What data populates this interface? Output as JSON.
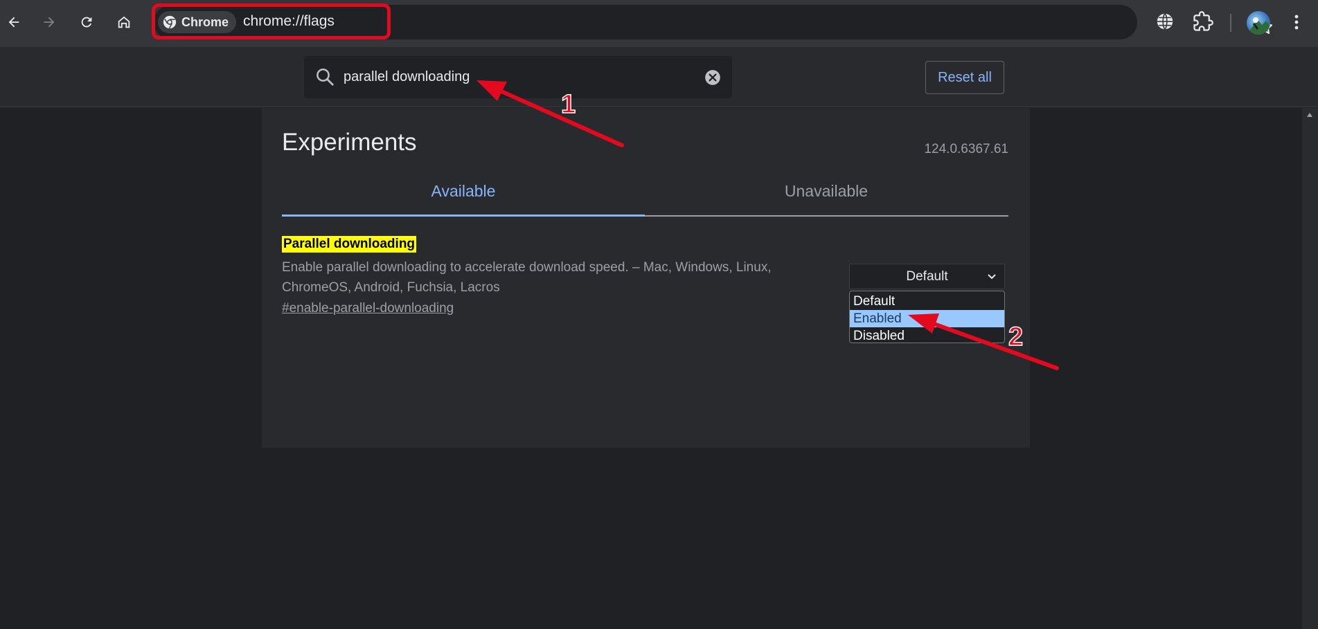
{
  "browser": {
    "chip_label": "Chrome",
    "url": "chrome://flags",
    "icons": {
      "back": "arrow-left-icon",
      "forward": "arrow-right-icon",
      "reload": "reload-icon",
      "home": "home-icon",
      "bookmark": "star-icon",
      "translate": "globe-icon",
      "extensions": "puzzle-icon",
      "menu": "kebab-icon"
    }
  },
  "header": {
    "search_value": "parallel downloading",
    "reset_label": "Reset all"
  },
  "main": {
    "title": "Experiments",
    "version": "124.0.6367.61",
    "tabs": [
      {
        "label": "Available",
        "active": true
      },
      {
        "label": "Unavailable",
        "active": false
      }
    ],
    "flag": {
      "name": "Parallel downloading",
      "description": "Enable parallel downloading to accelerate download speed. – Mac, Windows, Linux, ChromeOS, Android, Fuchsia, Lacros",
      "link": "#enable-parallel-downloading",
      "select_value": "Default",
      "options": [
        "Default",
        "Enabled",
        "Disabled"
      ],
      "highlighted_option": "Enabled"
    }
  },
  "annotations": {
    "step1": "1",
    "step2": "2",
    "color": "#e3091f"
  },
  "colors": {
    "accent": "#8ab4f8",
    "highlight": "#ffff00",
    "option_selected": "#99c8ff"
  }
}
